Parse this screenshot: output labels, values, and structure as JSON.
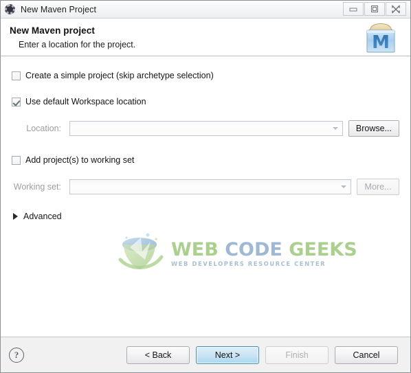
{
  "window": {
    "title": "New Maven Project",
    "icon": "maven-gear-icon",
    "controls": {
      "minimize": "minimize-icon",
      "maximize": "maximize-icon",
      "close": "close-icon"
    }
  },
  "header": {
    "title": "New Maven project",
    "subtitle": "Enter a location for the project.",
    "icon": "maven-box-icon",
    "icon_letter": "M"
  },
  "form": {
    "simple_project": {
      "label": "Create a simple project (skip archetype selection)",
      "checked": false
    },
    "default_workspace": {
      "label": "Use default Workspace location",
      "checked": true
    },
    "location": {
      "label": "Location:",
      "value": "",
      "placeholder": "",
      "enabled": false,
      "browse_label": "Browse..."
    },
    "working_set_checkbox": {
      "label": "Add project(s) to working set",
      "checked": false
    },
    "working_set": {
      "label": "Working set:",
      "value": "",
      "placeholder": "",
      "enabled": false,
      "more_label": "More..."
    },
    "advanced": {
      "label": "Advanced",
      "expanded": false
    }
  },
  "watermark": {
    "word1": "WEB",
    "word2": "CODE",
    "word3": "GEEKS",
    "tagline": "WEB DEVELOPERS RESOURCE CENTER",
    "colors": {
      "green": "#8cbf63",
      "blue": "#7b9ec4",
      "tagline": "#8aa6c0"
    }
  },
  "footer": {
    "help": "?",
    "back_label": "< Back",
    "next_label": "Next >",
    "finish_label": "Finish",
    "cancel_label": "Cancel",
    "default_button": "next",
    "disabled_buttons": [
      "finish"
    ]
  },
  "colors": {
    "dialog_bg": "#ffffff",
    "footer_bg": "#f1f1f2",
    "border": "#8d9097",
    "default_button_border": "#3c8dbc",
    "disabled_text": "#a8abaf"
  }
}
